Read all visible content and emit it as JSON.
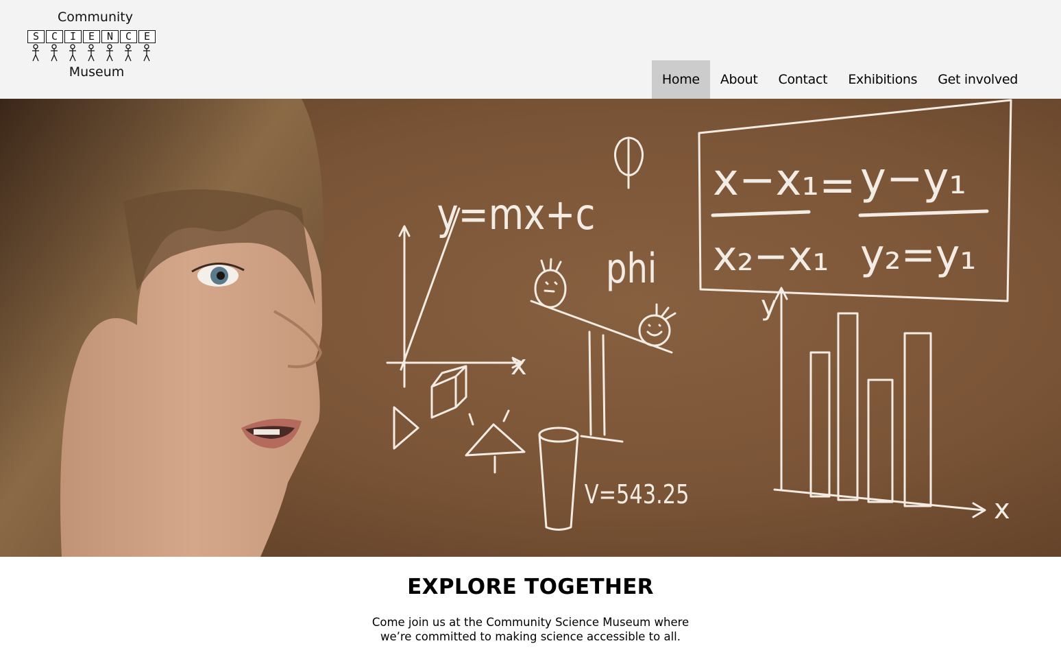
{
  "logo": {
    "top_text": "Community",
    "letters": [
      "S",
      "C",
      "I",
      "E",
      "N",
      "C",
      "E"
    ],
    "bottom_text": "Museum"
  },
  "nav": {
    "items": [
      {
        "label": "Home",
        "active": true
      },
      {
        "label": "About",
        "active": false
      },
      {
        "label": "Contact",
        "active": false
      },
      {
        "label": "Exhibitions",
        "active": false
      },
      {
        "label": "Get involved",
        "active": false
      }
    ]
  },
  "hero": {
    "chalk": {
      "equation_line": "y=mx+c",
      "phi_word": "phi",
      "volume": "V=543.25",
      "axis_x": "x",
      "axis_y": "y",
      "formula_left_top": "x−x₁",
      "formula_left_bottom": "x₂−x₁",
      "formula_equals": "=",
      "formula_right_top": "y−y₁",
      "formula_right_bottom": "y₂=y₁"
    }
  },
  "main": {
    "heading": "EXPLORE TOGETHER",
    "intro": "Come join us at the Community Science Museum where we’re committed to making science accessible to all."
  },
  "colors": {
    "header_bg": "#f3f3f3",
    "active_nav_bg": "#cccccc",
    "chalkboard": "#7a5638",
    "chalk": "#f2ece4"
  }
}
